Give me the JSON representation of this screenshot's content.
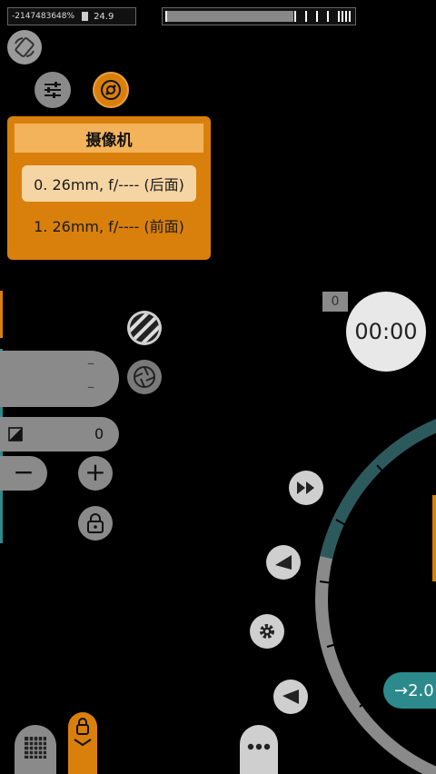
{
  "status": {
    "memory": "-2147483648%",
    "temp": "24.9"
  },
  "camera_menu": {
    "title": "摄像机",
    "options": [
      {
        "label": "0. 26mm, f/---- (后面)",
        "selected": true
      },
      {
        "label": "1. 26mm, f/---- (前面)",
        "selected": false
      }
    ]
  },
  "exposure": {
    "value": "0",
    "minus": "−",
    "plus": "+"
  },
  "slider_marks": [
    "–",
    "–"
  ],
  "photo_counter": "0",
  "timer": "00:00",
  "zoom_label": "→2.0",
  "colors": {
    "accent_orange": "#d9800c",
    "teal": "#2c5a5c",
    "gray": "#8a8a8a"
  }
}
